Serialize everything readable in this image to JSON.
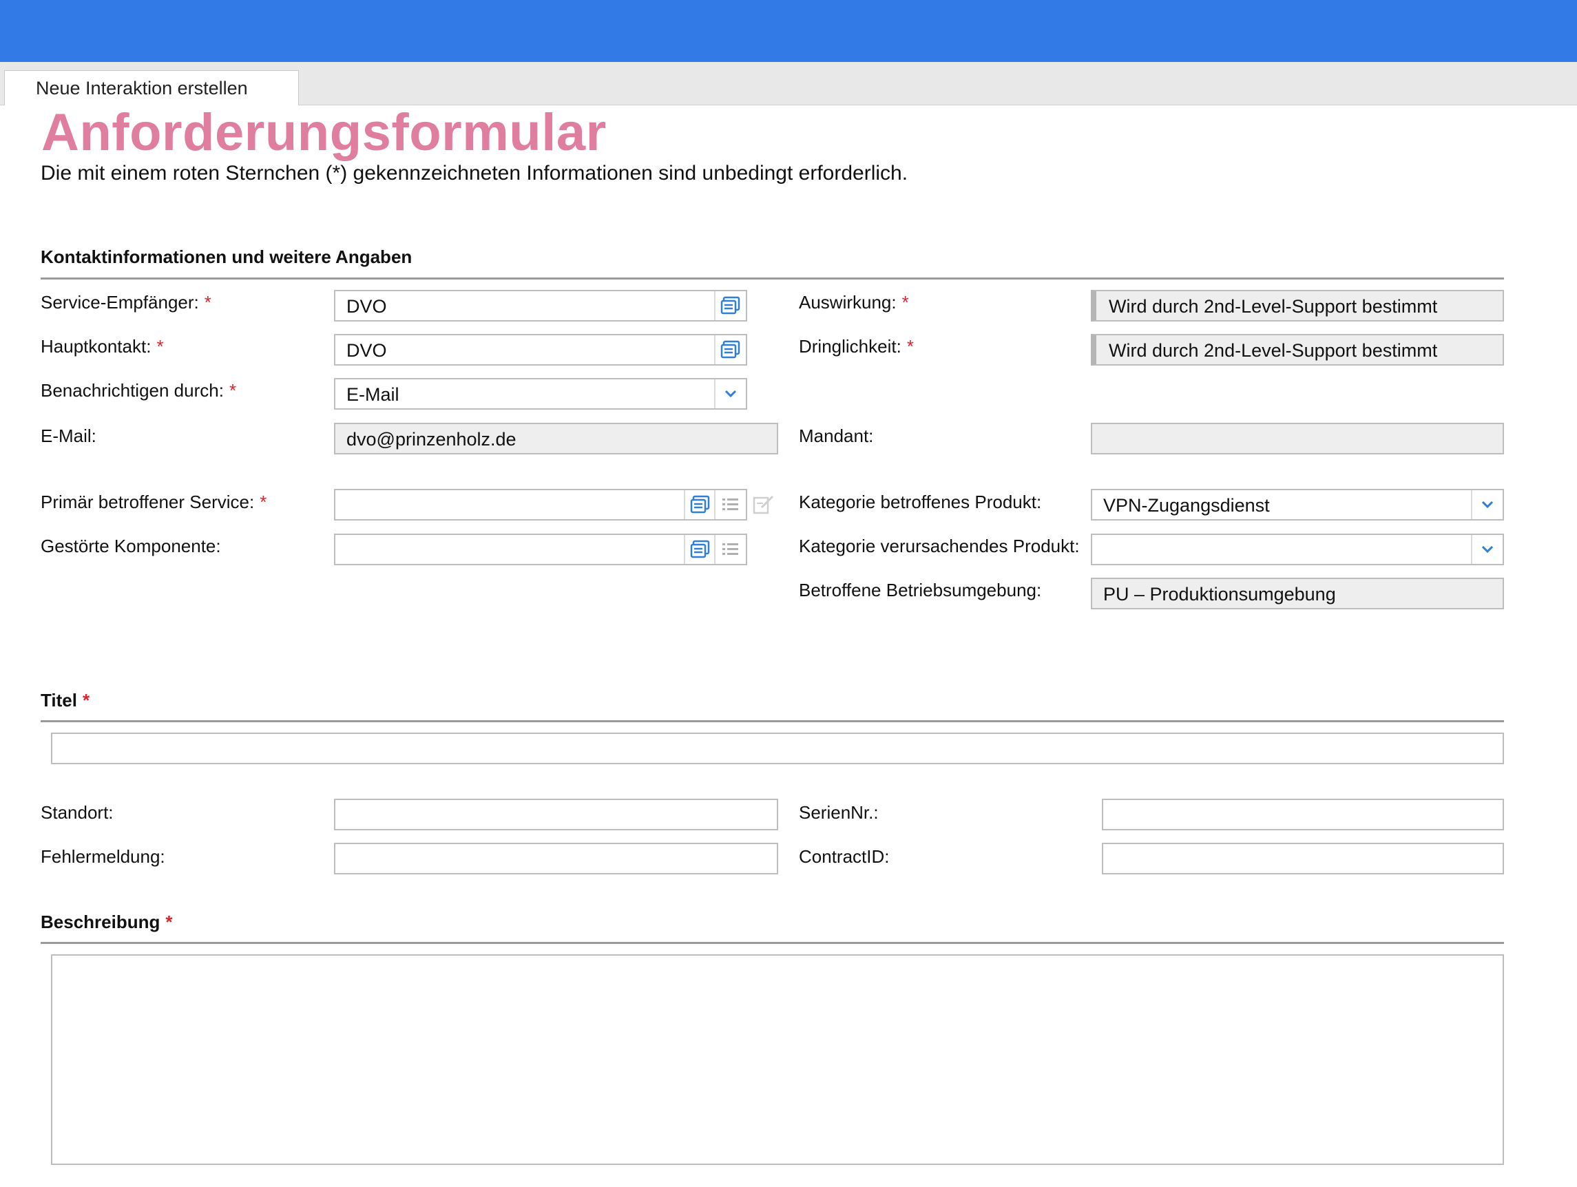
{
  "tab": {
    "label": "Neue Interaktion erstellen"
  },
  "page": {
    "title": "Anforderungsformular",
    "subtitle": "Die mit einem roten Sternchen (*) gekennzeichneten Informationen sind unbedingt erforderlich."
  },
  "contact_section": {
    "heading": "Kontaktinformationen und weitere Angaben",
    "service_recipient": {
      "label": "Service-Empfänger:",
      "value": "DVO"
    },
    "main_contact": {
      "label": "Hauptkontakt:",
      "value": "DVO"
    },
    "notify_by": {
      "label": "Benachrichtigen durch:",
      "value": "E-Mail"
    },
    "email": {
      "label": "E-Mail:",
      "value": "dvo@prinzenholz.de"
    },
    "primary_service": {
      "label": "Primär betroffener Service:",
      "value": ""
    },
    "faulty_component": {
      "label": "Gestörte Komponente:",
      "value": ""
    },
    "impact": {
      "label": "Auswirkung:",
      "value": "Wird durch 2nd-Level-Support bestimmt"
    },
    "urgency": {
      "label": "Dringlichkeit:",
      "value": "Wird durch 2nd-Level-Support bestimmt"
    },
    "tenant": {
      "label": "Mandant:",
      "value": ""
    },
    "affected_product_category": {
      "label": "Kategorie betroffenes Produkt:",
      "value": "VPN-Zugangsdienst"
    },
    "causing_product_category": {
      "label": "Kategorie verursachendes Produkt:",
      "value": ""
    },
    "environment": {
      "label": "Betroffene Betriebsumgebung:",
      "value": "PU – Produktionsumgebung"
    }
  },
  "title_section": {
    "heading": "Titel",
    "value": ""
  },
  "extra": {
    "location": {
      "label": "Standort:",
      "value": ""
    },
    "error_message": {
      "label": "Fehlermeldung:",
      "value": ""
    },
    "serial_no": {
      "label": "SerienNr.:",
      "value": ""
    },
    "contract_id": {
      "label": "ContractID:",
      "value": ""
    }
  },
  "description_section": {
    "heading": "Beschreibung",
    "value": ""
  },
  "required_marker": "*",
  "colors": {
    "topbar": "#327be7",
    "title": "#e07ea0",
    "required": "#d9262f",
    "icon_blue": "#2f7fd6"
  }
}
